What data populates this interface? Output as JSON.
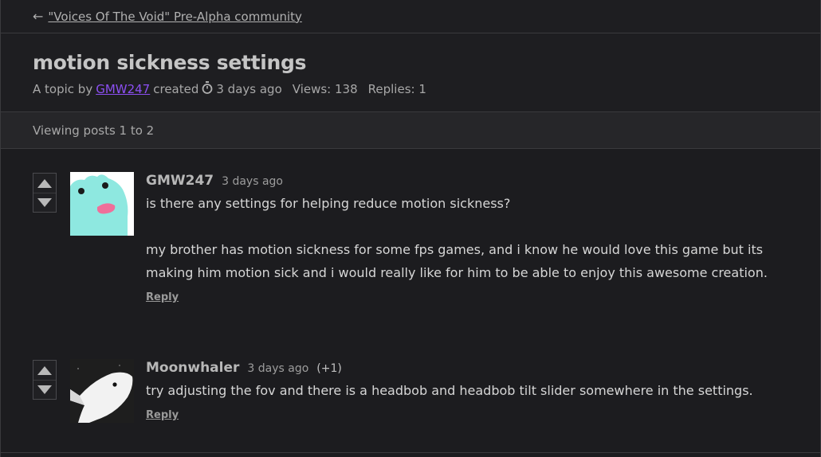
{
  "nav": {
    "back_arrow": "←",
    "back_label": "\"Voices Of The Void\" Pre-Alpha community"
  },
  "topic": {
    "title": "motion sickness settings",
    "meta_prefix": "A topic by",
    "author": "GMW247",
    "meta_created": "created",
    "clock_icon": "stopwatch-icon",
    "created_ago": "3 days ago",
    "views": "Views: 138",
    "replies": "Replies: 1"
  },
  "viewing": "Viewing posts 1 to 2",
  "posts": [
    {
      "author": "GMW247",
      "time": "3 days ago",
      "score": "",
      "paragraphs": [
        "is there any settings for helping reduce motion sickness?",
        "my brother has motion sickness for some fps games, and i know he would love this game but its making him motion sick and i would really like for him to be able to enjoy this awesome creation."
      ],
      "reply_label": "Reply",
      "avatar_icon": "frog-avatar"
    },
    {
      "author": "Moonwhaler",
      "time": "3 days ago",
      "score": "(+1)",
      "paragraphs": [
        "try adjusting the fov and there is a headbob and headbob tilt slider somewhere in the settings."
      ],
      "reply_label": "Reply",
      "avatar_icon": "whale-avatar"
    }
  ],
  "colors": {
    "background": "#1c1c1f",
    "link_purple": "#8c4ff3",
    "frog_teal": "#8ee8e0"
  }
}
